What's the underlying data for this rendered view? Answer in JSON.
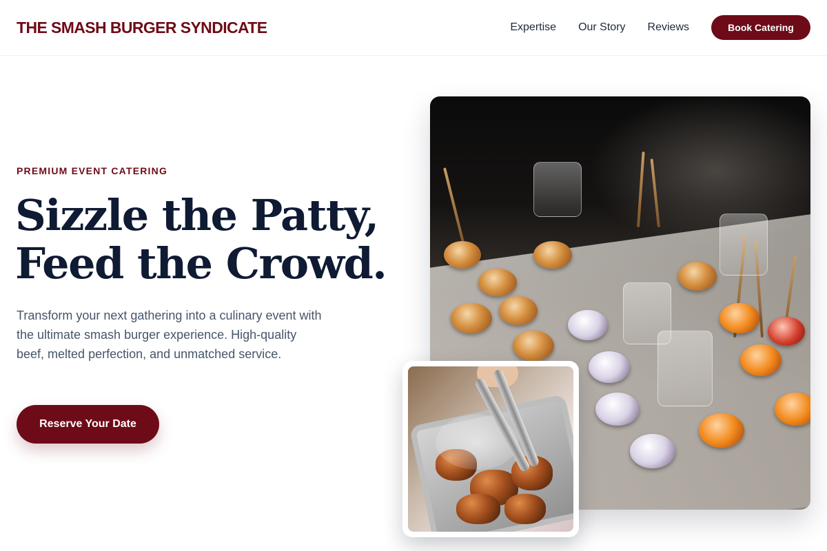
{
  "header": {
    "logo": "THE SMASH BURGER SYNDICATE",
    "nav": [
      {
        "label": "Expertise"
      },
      {
        "label": "Our Story"
      },
      {
        "label": "Reviews"
      }
    ],
    "cta_label": "Book Catering"
  },
  "hero": {
    "eyebrow": "PREMIUM EVENT CATERING",
    "headline_line1": "Sizzle the Patty,",
    "headline_line2": "Feed the Crowd.",
    "description": "Transform your next gathering into a culinary event with the ultimate smash burger experience. High-quality beef, melted perfection, and unmatched service.",
    "cta_label": "Reserve Your Date"
  },
  "images": {
    "main_photo": "catering-appetizers-tray",
    "inset_photo": "grilled-meat-with-tongs"
  },
  "colors": {
    "brand": "#6e0b18",
    "heading": "#0f1a33",
    "body_text": "#475569",
    "nav_text": "#1e293b"
  }
}
